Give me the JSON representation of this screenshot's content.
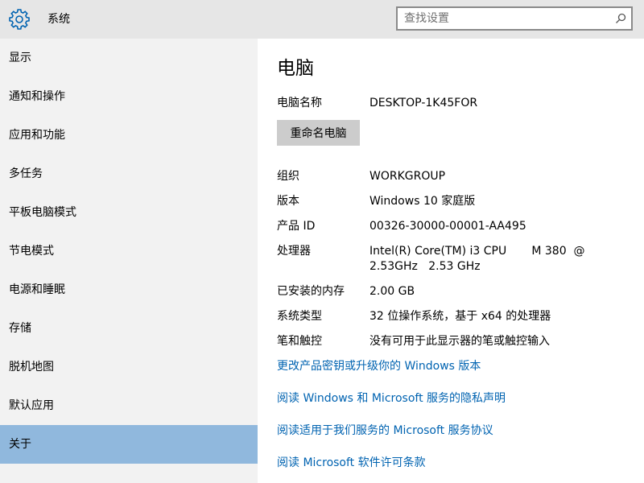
{
  "header": {
    "title": "系统",
    "gear_icon": "gear-icon",
    "search_placeholder": "查找设置",
    "search_value": "",
    "search_icon": "search-icon"
  },
  "sidebar": {
    "items": [
      {
        "label": "显示",
        "selected": false
      },
      {
        "label": "通知和操作",
        "selected": false
      },
      {
        "label": "应用和功能",
        "selected": false
      },
      {
        "label": "多任务",
        "selected": false
      },
      {
        "label": "平板电脑模式",
        "selected": false
      },
      {
        "label": "节电模式",
        "selected": false
      },
      {
        "label": "电源和睡眠",
        "selected": false
      },
      {
        "label": "存储",
        "selected": false
      },
      {
        "label": "脱机地图",
        "selected": false
      },
      {
        "label": "默认应用",
        "selected": false
      },
      {
        "label": "关于",
        "selected": true
      }
    ],
    "selected_color": "#90b8dd"
  },
  "main": {
    "title": "电脑",
    "pc_name": {
      "label": "电脑名称",
      "value": "DESKTOP-1K45FOR"
    },
    "rename_button": "重命名电脑",
    "info": [
      {
        "label": "组织",
        "value": "WORKGROUP"
      },
      {
        "label": "版本",
        "value": "Windows 10 家庭版"
      },
      {
        "label": "产品 ID",
        "value": "00326-30000-00001-AA495"
      },
      {
        "label": "处理器",
        "value": "Intel(R) Core(TM) i3 CPU       M 380  @\n2.53GHz   2.53 GHz"
      },
      {
        "label": "已安装的内存",
        "value": "2.00 GB"
      },
      {
        "label": "系统类型",
        "value": "32 位操作系统，基于 x64 的处理器"
      },
      {
        "label": "笔和触控",
        "value": "没有可用于此显示器的笔或触控输入"
      }
    ],
    "links": [
      "更改产品密钥或升级你的 Windows 版本",
      "阅读 Windows 和 Microsoft 服务的隐私声明",
      "阅读适用于我们服务的 Microsoft 服务协议",
      "阅读 Microsoft 软件许可条款"
    ],
    "link_color": "#0063b1"
  }
}
